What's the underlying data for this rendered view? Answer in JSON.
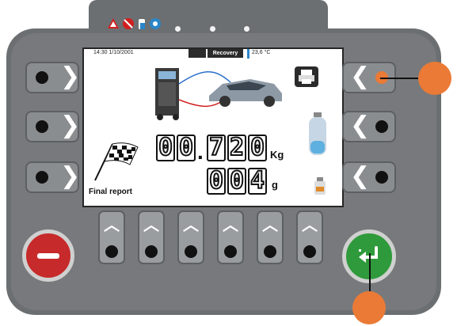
{
  "screen": {
    "status": {
      "time": "14:30 1/10/2001",
      "mode": "Recovery",
      "temperature": "23,6 °C"
    },
    "final_label": "Final report",
    "weight": {
      "digits": [
        "0",
        "0",
        ".",
        "7",
        "2",
        "0"
      ],
      "unit": "Kg"
    },
    "amount": {
      "digits": [
        "0",
        "0",
        "4"
      ],
      "unit": "g"
    }
  },
  "indicators": {
    "icons": [
      "warning-icon",
      "no-entry-icon",
      "bottle-icon",
      "fan-icon"
    ],
    "colors": {
      "warning": "#d11f1f",
      "no_entry": "#d11f1f",
      "bottle": "#2a86c9",
      "fan": "#2a86c9"
    }
  },
  "buttons": {
    "left_chevron": "❯",
    "right_chevron": "❮",
    "bottom_arrow": "︿"
  },
  "colors": {
    "housing": "#6c6f72",
    "cancel": "#c62a2a",
    "confirm": "#2f9a3b",
    "callout": "#ea7a36"
  }
}
